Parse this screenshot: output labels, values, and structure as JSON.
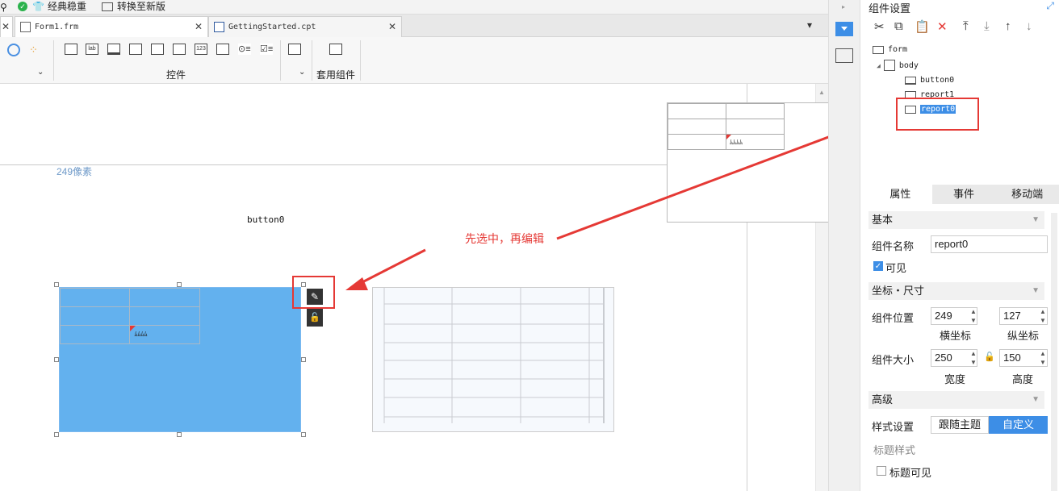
{
  "topbar": {
    "classic_label": "经典稳重",
    "convert_label": "转换至新版"
  },
  "tabs": [
    {
      "label": "Form1.frm",
      "close": "✕"
    },
    {
      "label": "GettingStarted.cpt",
      "close": "✕"
    }
  ],
  "ribbon": {
    "controls_label": "控件",
    "template_label": "套用组件"
  },
  "canvas": {
    "ruler_text": "249像素",
    "button_label": "button0",
    "annotation": "先选中，再编辑",
    "report_text": "ﾑﾑﾑﾑ",
    "popup_text": "ﾑﾑﾑﾑ"
  },
  "panel": {
    "title": "组件设置",
    "tree": [
      {
        "label": "form"
      },
      {
        "label": "body"
      },
      {
        "label": "button0"
      },
      {
        "label": "report1"
      },
      {
        "label": "report0"
      }
    ],
    "tabs": [
      "属性",
      "事件",
      "移动端"
    ],
    "section_basic": "基本",
    "name_label": "组件名称",
    "name_value": "report0",
    "visible_label": "可见",
    "section_coords": "坐标・尺寸",
    "position_label": "组件位置",
    "pos_x": "249",
    "pos_y": "127",
    "x_caption": "横坐标",
    "y_caption": "纵坐标",
    "size_label": "组件大小",
    "width": "250",
    "height": "150",
    "w_caption": "宽度",
    "h_caption": "高度",
    "section_advanced": "高级",
    "style_label": "样式设置",
    "style_follow": "跟随主题",
    "style_custom": "自定义",
    "title_style_label": "标题样式",
    "title_visible_label": "标题可见"
  },
  "colors": {
    "accent": "#3d8ee6",
    "selection_fill": "#63b1ee",
    "annotation_red": "#e53935"
  }
}
